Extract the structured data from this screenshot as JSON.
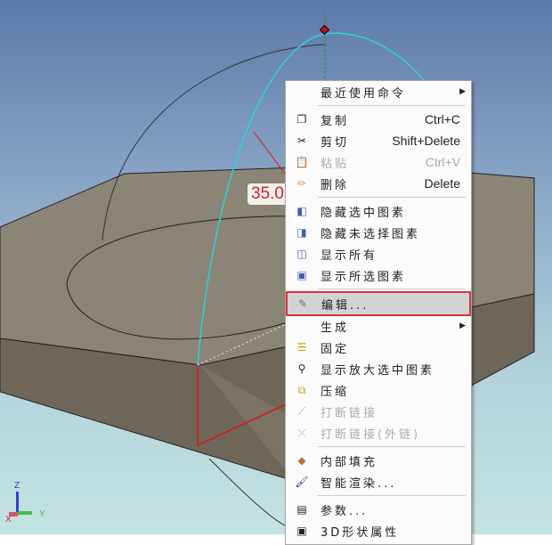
{
  "viewport": {
    "dimension_value": "35.0",
    "axes": {
      "x": "X",
      "y": "Y",
      "z": "Z"
    }
  },
  "menu": {
    "items": [
      {
        "label": "最近使用命令",
        "submenu": true,
        "icon": "none"
      },
      {
        "sep": true
      },
      {
        "label": "复制",
        "shortcut": "Ctrl+C",
        "icon": "copy-icon"
      },
      {
        "label": "剪切",
        "shortcut": "Shift+Delete",
        "icon": "scissors-icon"
      },
      {
        "label": "粘贴",
        "shortcut": "Ctrl+V",
        "icon": "paste-icon",
        "disabled": true
      },
      {
        "label": "删除",
        "shortcut": "Delete",
        "icon": "eraser-icon"
      },
      {
        "sep": true
      },
      {
        "label": "隐藏选中图素",
        "icon": "hide-selected-icon"
      },
      {
        "label": "隐藏未选择图素",
        "icon": "hide-unselected-icon"
      },
      {
        "label": "显示所有",
        "icon": "show-all-icon"
      },
      {
        "label": "显示所选图素",
        "icon": "show-selected-icon"
      },
      {
        "sep": true
      },
      {
        "label": "编辑...",
        "icon": "edit-icon",
        "highlighted": true
      },
      {
        "label": "生成",
        "submenu": true,
        "icon": "none"
      },
      {
        "label": "固定",
        "icon": "anchor-icon"
      },
      {
        "label": "显示放大选中图素",
        "icon": "zoom-icon"
      },
      {
        "label": "压缩",
        "icon": "compress-icon"
      },
      {
        "label": "打断链接",
        "icon": "break-link-icon",
        "disabled": true
      },
      {
        "label": "打断链接(外链)",
        "icon": "break-external-link-icon",
        "disabled": true
      },
      {
        "sep": true
      },
      {
        "label": "内部填充",
        "icon": "fill-icon"
      },
      {
        "label": "智能渲染...",
        "icon": "brush-icon"
      },
      {
        "sep": true
      },
      {
        "label": "参数...",
        "icon": "parameters-icon"
      },
      {
        "label": "3D形状属性",
        "icon": "properties-icon"
      }
    ]
  }
}
